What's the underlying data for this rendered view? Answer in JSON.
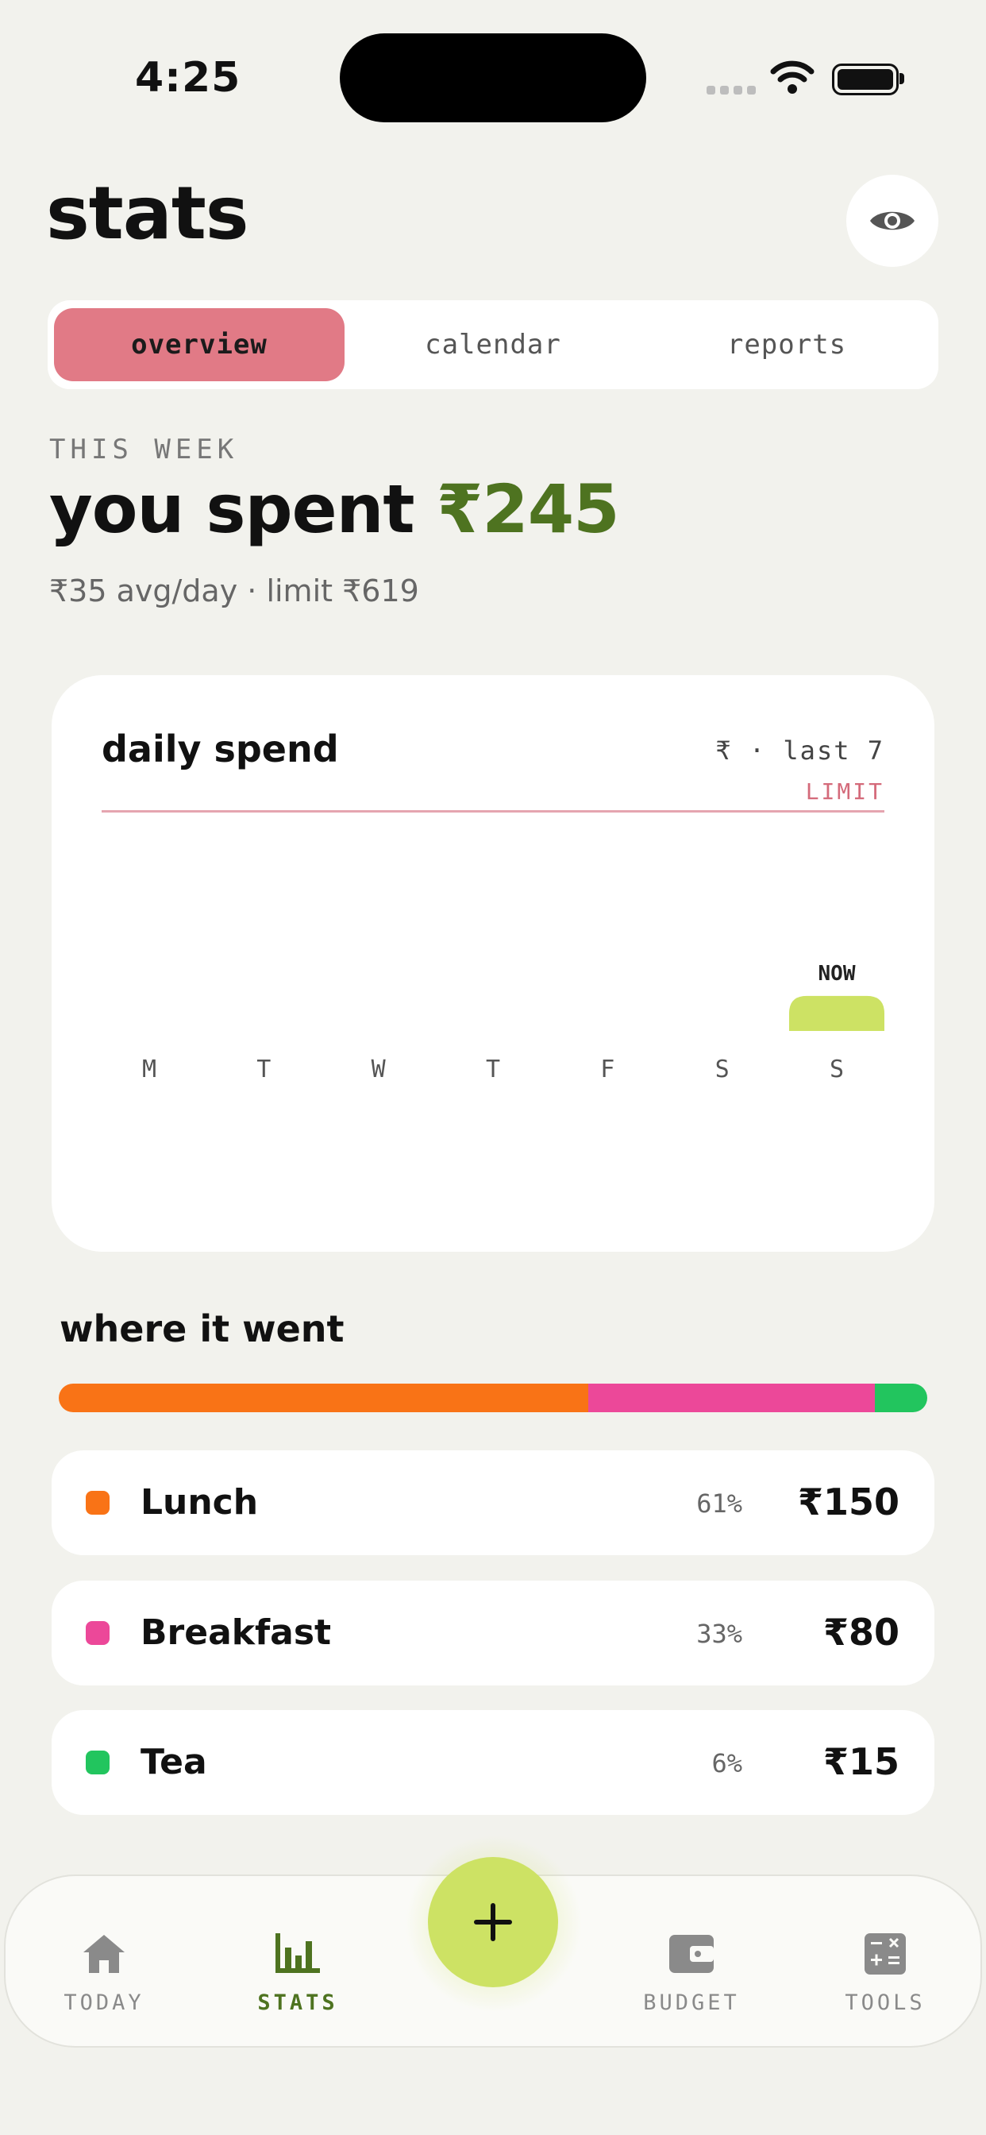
{
  "status_bar": {
    "time": "4:25"
  },
  "header": {
    "title": "stats",
    "visibility_icon": "eye-icon"
  },
  "tabs": [
    {
      "label": "overview",
      "active": true
    },
    {
      "label": "calendar",
      "active": false
    },
    {
      "label": "reports",
      "active": false
    }
  ],
  "summary": {
    "period_label": "THIS WEEK",
    "spent_prefix": "you spent",
    "spent_amount": "₹245",
    "subline": "₹35 avg/day · limit ₹619"
  },
  "daily_chart": {
    "title": "daily spend",
    "meta": "₹ · last 7",
    "limit_label": "LIMIT",
    "now_label": "NOW",
    "bar_color": "#CDE264",
    "limit_color": "#E5A5B0"
  },
  "chart_data": {
    "type": "bar",
    "categories": [
      "M",
      "T",
      "W",
      "T",
      "F",
      "S",
      "S"
    ],
    "values": [
      0,
      0,
      0,
      0,
      0,
      0,
      245
    ],
    "limit": 619,
    "ylim": [
      0,
      1510
    ],
    "annotations": [
      {
        "category_index": 6,
        "text": "NOW"
      }
    ]
  },
  "breakdown": {
    "title": "where it went",
    "categories": [
      {
        "name": "Lunch",
        "percent": "61%",
        "amount": "₹150",
        "share": 61,
        "color": "#F97316"
      },
      {
        "name": "Breakfast",
        "percent": "33%",
        "amount": "₹80",
        "share": 33,
        "color": "#EC4899"
      },
      {
        "name": "Tea",
        "percent": "6%",
        "amount": "₹15",
        "share": 6,
        "color": "#22C55E"
      }
    ]
  },
  "nav": {
    "items": [
      {
        "label": "TODAY",
        "icon": "home-icon",
        "active": false
      },
      {
        "label": "STATS",
        "icon": "bar-chart-icon",
        "active": true
      },
      {
        "label": "BUDGET",
        "icon": "wallet-icon",
        "active": false
      },
      {
        "label": "TOOLS",
        "icon": "calculator-icon",
        "active": false
      }
    ],
    "fab_icon": "plus-icon"
  },
  "colors": {
    "background": "#F2F2ED",
    "accent_green": "#4E7320",
    "active_tab": "#E17A86",
    "fab": "#CDE264"
  }
}
